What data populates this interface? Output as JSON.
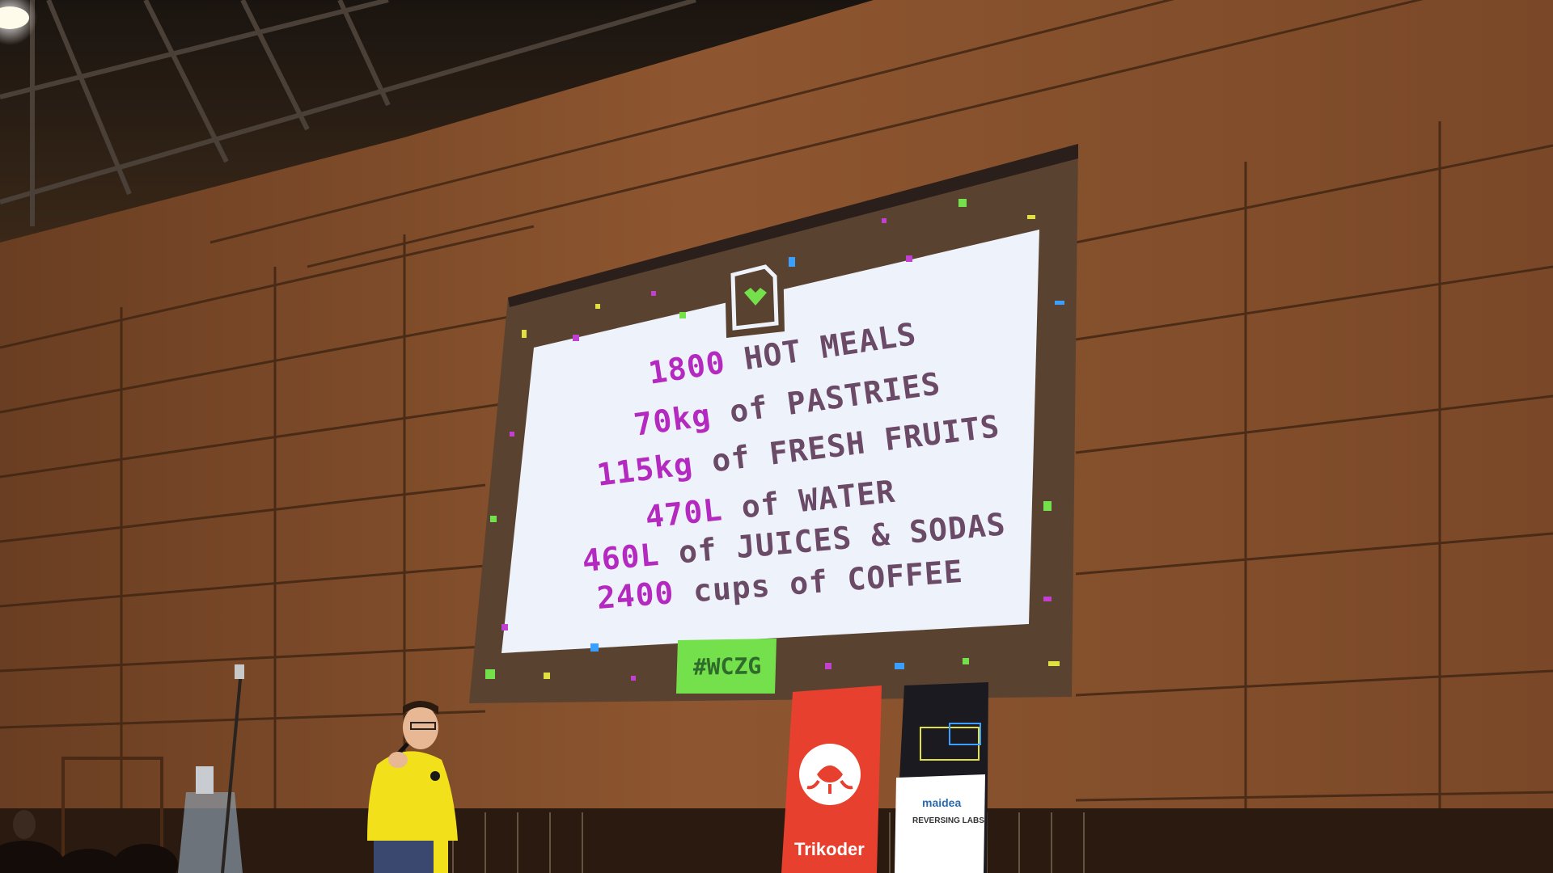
{
  "slide": {
    "lines": [
      {
        "num": "1800",
        "text": " HOT MEALS"
      },
      {
        "num": "70kg",
        "text": " of PASTRIES"
      },
      {
        "num": "115kg",
        "text": " of FRESH FRUITS"
      },
      {
        "num": "470L",
        "text": " of WATER"
      },
      {
        "num": "460L",
        "text": " of JUICES & SODAS"
      },
      {
        "num": "2400",
        "text": " cups of COFFEE"
      }
    ],
    "hashtag": "#WCZG"
  },
  "banners": {
    "trikoder": "Trikoder",
    "sponsor_1": "maidea",
    "sponsor_2": "REVERSING LABS"
  },
  "colors": {
    "slide_bg": "#eef3fb",
    "slide_text": "#6a4a66",
    "slide_accent": "#b42ac0",
    "hashtag_bg": "#74e04c",
    "wall": "#8a5430",
    "hoodie": "#f2e01a",
    "banner_red": "#e8402e"
  }
}
